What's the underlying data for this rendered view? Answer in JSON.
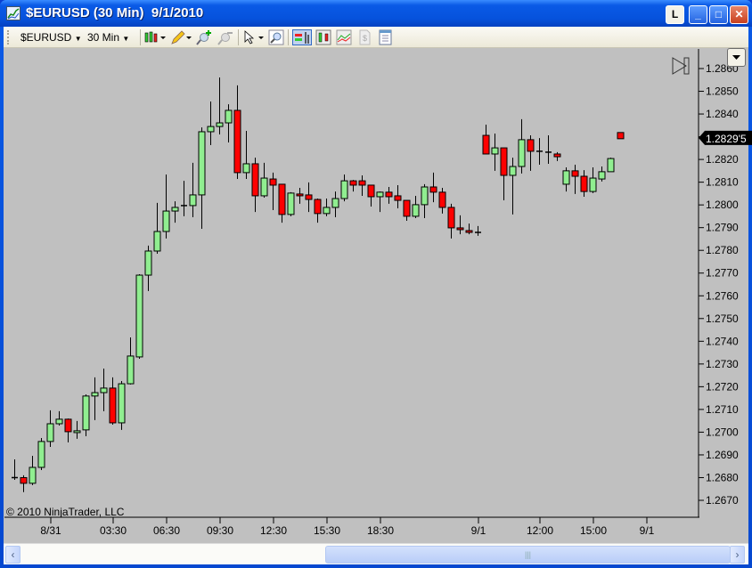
{
  "window": {
    "title": "$EURUSD (30 Min)  9/1/2010",
    "buttons": {
      "l": "L",
      "minimize": "_",
      "maximize": "□",
      "close": "✕"
    }
  },
  "toolbar": {
    "instrument": "$EURUSD",
    "interval": "30 Min",
    "icons": [
      "candlestick-style-icon",
      "pencil-draw-icon",
      "zoom-in-icon",
      "zoom-out-icon",
      "cursor-pointer-icon",
      "magnifier-icon",
      "data-box-icon",
      "bar-chart-icon",
      "indicators-icon",
      "strategy-icon",
      "properties-icon"
    ]
  },
  "chart": {
    "copyright": "© 2010 NinjaTrader, LLC",
    "last_price_label": "1.2829'5",
    "last_price": 1.28295,
    "colors": {
      "up": "#90ee90",
      "down": "#ff0000",
      "background": "#c0c0c0",
      "last_price_bg": "#000000"
    },
    "y_axis": {
      "min": 1.267,
      "max": 1.286,
      "step": 0.001,
      "labels": [
        "1.2860",
        "1.2850",
        "1.2840",
        "1.2830",
        "1.2820",
        "1.2810",
        "1.2800",
        "1.2790",
        "1.2780",
        "1.2770",
        "1.2760",
        "1.2750",
        "1.2740",
        "1.2730",
        "1.2720",
        "1.2710",
        "1.2700",
        "1.2690",
        "1.2680",
        "1.2670"
      ]
    },
    "x_axis": {
      "labels": [
        {
          "bar": 4,
          "text": "8/31"
        },
        {
          "bar": 11,
          "text": "03:30"
        },
        {
          "bar": 17,
          "text": "06:30"
        },
        {
          "bar": 23,
          "text": "09:30"
        },
        {
          "bar": 29,
          "text": "12:30"
        },
        {
          "bar": 35,
          "text": "15:30"
        },
        {
          "bar": 41,
          "text": "18:30"
        },
        {
          "bar": 52,
          "text": "9/1"
        },
        {
          "bar": 59,
          "text": "12:00"
        },
        {
          "bar": 65,
          "text": "15:00"
        },
        {
          "bar": 71,
          "text": "9/1"
        }
      ]
    }
  },
  "chart_data": {
    "type": "candlestick",
    "columns": [
      "open",
      "high",
      "low",
      "close"
    ],
    "ylim": [
      1.2665,
      1.2866
    ],
    "bars": [
      [
        1.268,
        1.2688,
        1.2679,
        1.268
      ],
      [
        1.268,
        1.2681,
        1.26736,
        1.26775
      ],
      [
        1.26775,
        1.26896,
        1.26767,
        1.26845
      ],
      [
        1.26845,
        1.26974,
        1.26833,
        1.26959
      ],
      [
        1.26959,
        1.27096,
        1.26935,
        1.27037
      ],
      [
        1.27037,
        1.27092,
        1.27029,
        1.27057
      ],
      [
        1.27057,
        1.2706,
        1.26955,
        1.27002
      ],
      [
        1.26998,
        1.27049,
        1.26971,
        1.27006
      ],
      [
        1.2701,
        1.27166,
        1.26982,
        1.27159
      ],
      [
        1.27159,
        1.27241,
        1.27053,
        1.27174
      ],
      [
        1.27174,
        1.2728,
        1.27092,
        1.27194
      ],
      [
        1.27194,
        1.27241,
        1.27033,
        1.27041
      ],
      [
        1.27041,
        1.27225,
        1.2701,
        1.27213
      ],
      [
        1.27213,
        1.27417,
        1.2721,
        1.27335
      ],
      [
        1.27331,
        1.27695,
        1.27323,
        1.27691
      ],
      [
        1.27691,
        1.27821,
        1.27621,
        1.27797
      ],
      [
        1.27797,
        1.28009,
        1.27785,
        1.27883
      ],
      [
        1.27883,
        1.28134,
        1.27852,
        1.27973
      ],
      [
        1.27973,
        1.28016,
        1.27922,
        1.27989
      ],
      [
        1.27997,
        1.28106,
        1.2795,
        1.27997
      ],
      [
        1.27997,
        1.28185,
        1.27946,
        1.28044
      ],
      [
        1.28044,
        1.28341,
        1.27895,
        1.28322
      ],
      [
        1.28322,
        1.28455,
        1.28263,
        1.28345
      ],
      [
        1.28345,
        1.28561,
        1.2831,
        1.28361
      ],
      [
        1.28361,
        1.28443,
        1.28275,
        1.28416
      ],
      [
        1.28416,
        1.28526,
        1.28114,
        1.28142
      ],
      [
        1.28142,
        1.28326,
        1.28114,
        1.28181
      ],
      [
        1.28181,
        1.28208,
        1.27969,
        1.2804
      ],
      [
        1.2804,
        1.28185,
        1.28032,
        1.28118
      ],
      [
        1.28114,
        1.28142,
        1.27977,
        1.28087
      ],
      [
        1.28091,
        1.28091,
        1.27922,
        1.27958
      ],
      [
        1.27958,
        1.28056,
        1.2795,
        1.28052
      ],
      [
        1.28048,
        1.28075,
        1.28005,
        1.2804
      ],
      [
        1.28044,
        1.28099,
        1.27969,
        1.28024
      ],
      [
        1.28024,
        1.28028,
        1.27922,
        1.27962
      ],
      [
        1.27962,
        1.28028,
        1.2795,
        1.27989
      ],
      [
        1.27989,
        1.28059,
        1.27946,
        1.28028
      ],
      [
        1.28028,
        1.28134,
        1.28016,
        1.28106
      ],
      [
        1.28106,
        1.2811,
        1.28059,
        1.28087
      ],
      [
        1.28106,
        1.2813,
        1.2804,
        1.28087
      ],
      [
        1.28087,
        1.28087,
        1.27993,
        1.28036
      ],
      [
        1.28036,
        1.28059,
        1.27969,
        1.28056
      ],
      [
        1.28056,
        1.28079,
        1.28005,
        1.28036
      ],
      [
        1.2804,
        1.28087,
        1.27985,
        1.2802
      ],
      [
        1.2802,
        1.2802,
        1.2793,
        1.2795
      ],
      [
        1.2795,
        1.2804,
        1.27942,
        1.28001
      ],
      [
        1.28001,
        1.28091,
        1.27942,
        1.28079
      ],
      [
        1.28079,
        1.28142,
        1.28012,
        1.28056
      ],
      [
        1.28056,
        1.28075,
        1.27962,
        1.27989
      ],
      [
        1.27989,
        1.28005,
        1.27852,
        1.27899
      ],
      [
        1.27899,
        1.27954,
        1.27871,
        1.27891
      ],
      [
        1.27887,
        1.27918,
        1.27871,
        1.27879
      ],
      [
        1.27879,
        1.27907,
        1.27864,
        1.27879
      ],
      [
        1.28306,
        1.28353,
        1.28224,
        1.28224
      ],
      [
        1.28224,
        1.28314,
        1.2815,
        1.28251
      ],
      [
        1.28251,
        1.28251,
        1.2802,
        1.2813
      ],
      [
        1.2813,
        1.28208,
        1.27958,
        1.28169
      ],
      [
        1.28169,
        1.28377,
        1.28138,
        1.28287
      ],
      [
        1.28287,
        1.28306,
        1.2815,
        1.28236
      ],
      [
        1.28236,
        1.28294,
        1.28177,
        1.28232
      ],
      [
        1.28232,
        1.28306,
        1.28181,
        1.28232
      ],
      [
        1.28224,
        1.28232,
        1.28193,
        1.28212
      ],
      [
        1.28091,
        1.28165,
        1.28059,
        1.2815
      ],
      [
        1.2815,
        1.28177,
        1.28048,
        1.28126
      ],
      [
        1.28126,
        1.28153,
        1.28036,
        1.28059
      ],
      [
        1.28059,
        1.28165,
        1.28052,
        1.28118
      ],
      [
        1.28114,
        1.28169,
        1.28103,
        1.28146
      ],
      [
        1.28146,
        1.28208,
        1.28146,
        1.28204
      ]
    ]
  }
}
